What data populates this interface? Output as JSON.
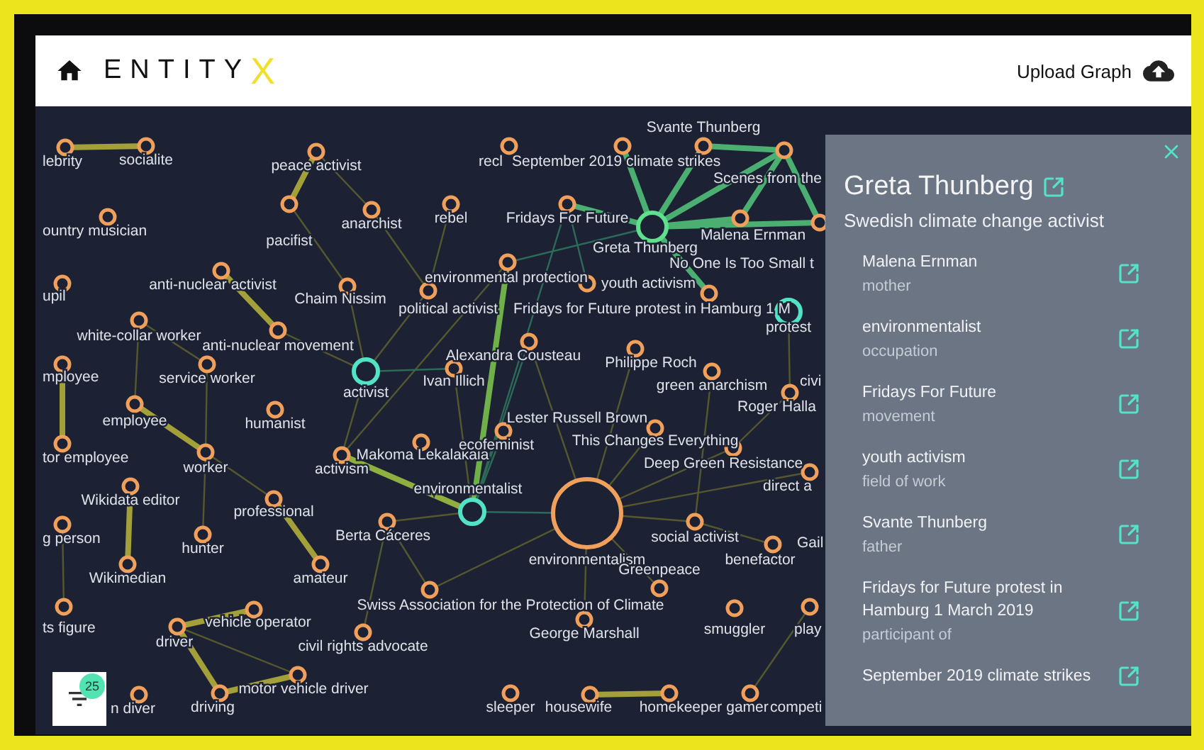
{
  "header": {
    "logo": {
      "word": "ENTITY",
      "mark": "X"
    },
    "upload_button": "Upload Graph"
  },
  "graph": {
    "nodes": [
      {
        "label": "lebrity",
        "kind": "normal"
      },
      {
        "label": "socialite",
        "kind": "normal"
      },
      {
        "label": "peace activist",
        "kind": "normal"
      },
      {
        "label": "pacifist",
        "kind": "normal"
      },
      {
        "label": "anarchist",
        "kind": "normal"
      },
      {
        "label": "rebel",
        "kind": "normal"
      },
      {
        "label": "ountry musician",
        "kind": "normal"
      },
      {
        "label": "upil",
        "kind": "normal"
      },
      {
        "label": "anti-nuclear activist",
        "kind": "normal"
      },
      {
        "label": "Chaim Nissim",
        "kind": "normal"
      },
      {
        "label": "environmental protection",
        "kind": "normal"
      },
      {
        "label": "political activist",
        "kind": "normal"
      },
      {
        "label": "white-collar worker",
        "kind": "normal"
      },
      {
        "label": "anti-nuclear movement",
        "kind": "normal"
      },
      {
        "label": "mployee",
        "kind": "normal"
      },
      {
        "label": "service worker",
        "kind": "normal"
      },
      {
        "label": "activist",
        "kind": "linked"
      },
      {
        "label": "employee",
        "kind": "normal"
      },
      {
        "label": "humanist",
        "kind": "normal"
      },
      {
        "label": "tor employee",
        "kind": "normal"
      },
      {
        "label": "worker",
        "kind": "normal"
      },
      {
        "label": "Wikidata editor",
        "kind": "normal"
      },
      {
        "label": "activism",
        "kind": "normal"
      },
      {
        "label": "Makoma Lekalakala",
        "kind": "normal"
      },
      {
        "label": "professional",
        "kind": "normal"
      },
      {
        "label": "g person",
        "kind": "normal"
      },
      {
        "label": "hunter",
        "kind": "normal"
      },
      {
        "label": "Wikimedian",
        "kind": "normal"
      },
      {
        "label": "amateur",
        "kind": "normal"
      },
      {
        "label": "Berta Cáceres",
        "kind": "normal"
      },
      {
        "label": "environmentalist",
        "kind": "linked"
      },
      {
        "label": "environmentalism",
        "kind": "hub"
      },
      {
        "label": "ts figure",
        "kind": "normal"
      },
      {
        "label": "vehicle operator",
        "kind": "normal"
      },
      {
        "label": "driver",
        "kind": "normal"
      },
      {
        "label": "civil rights advocate",
        "kind": "normal"
      },
      {
        "label": "Greenpeace",
        "kind": "normal"
      },
      {
        "label": "Swiss Association for the Protection of Climate",
        "kind": "normal"
      },
      {
        "label": "George Marshall",
        "kind": "normal"
      },
      {
        "label": "smuggler",
        "kind": "normal"
      },
      {
        "label": "play",
        "kind": "normal"
      },
      {
        "label": "n diver",
        "kind": "normal"
      },
      {
        "label": "motor vehicle driver",
        "kind": "normal"
      },
      {
        "label": "driving",
        "kind": "normal"
      },
      {
        "label": "sleeper",
        "kind": "normal"
      },
      {
        "label": "housewife",
        "kind": "normal"
      },
      {
        "label": "homekeeper",
        "kind": "normal"
      },
      {
        "label": "gamer",
        "kind": "normal"
      },
      {
        "label": "competi"
      },
      {
        "label": "social activist",
        "kind": "normal"
      },
      {
        "label": "benefactor",
        "kind": "normal"
      },
      {
        "label": "Gail"
      },
      {
        "label": "This Changes Everything",
        "kind": "normal"
      },
      {
        "label": "Lester Russell Brown",
        "kind": "normal"
      },
      {
        "label": "ecofeminist",
        "kind": "normal"
      },
      {
        "label": "Deep Green Resistance",
        "kind": "normal"
      },
      {
        "label": "direct a"
      },
      {
        "label": "Alexandra Cousteau",
        "kind": "normal"
      },
      {
        "label": "Ivan Illich",
        "kind": "normal"
      },
      {
        "label": "Philippe Roch",
        "kind": "normal"
      },
      {
        "label": "green anarchism",
        "kind": "normal"
      },
      {
        "label": "civi"
      },
      {
        "label": "Roger Halla",
        "kind": "normal"
      },
      {
        "label": "youth activism",
        "kind": "normal"
      },
      {
        "label": "Fridays for Future protest in Hamburg 1 M",
        "kind": "normal"
      },
      {
        "label": "protest",
        "kind": "linked"
      },
      {
        "label": "Fridays For Future",
        "kind": "normal"
      },
      {
        "label": "Greta Thunberg",
        "kind": "focus"
      },
      {
        "label": "Malena Ernman",
        "kind": "normal"
      },
      {
        "label": "No One Is Too Small t",
        "kind": "normal"
      },
      {
        "label": "recl",
        "kind": "normal"
      },
      {
        "label": "September 2019 climate strikes",
        "kind": "normal"
      },
      {
        "label": "Svante Thunberg",
        "kind": "normal"
      },
      {
        "label": "Scenes from the",
        "kind": "normal"
      }
    ]
  },
  "filter": {
    "badge": "25"
  },
  "details": {
    "title": "Greta Thunberg",
    "description": "Swedish climate change activist",
    "items": [
      {
        "name": "Malena Ernman",
        "relation": "mother"
      },
      {
        "name": "environmentalist",
        "relation": "occupation"
      },
      {
        "name": "Fridays For Future",
        "relation": "movement"
      },
      {
        "name": "youth activism",
        "relation": "field of work"
      },
      {
        "name": "Svante Thunberg",
        "relation": "father"
      },
      {
        "name": "Fridays for Future protest in Hamburg 1 March 2019",
        "relation": "participant of"
      },
      {
        "name": "September 2019 climate strikes"
      }
    ]
  }
}
